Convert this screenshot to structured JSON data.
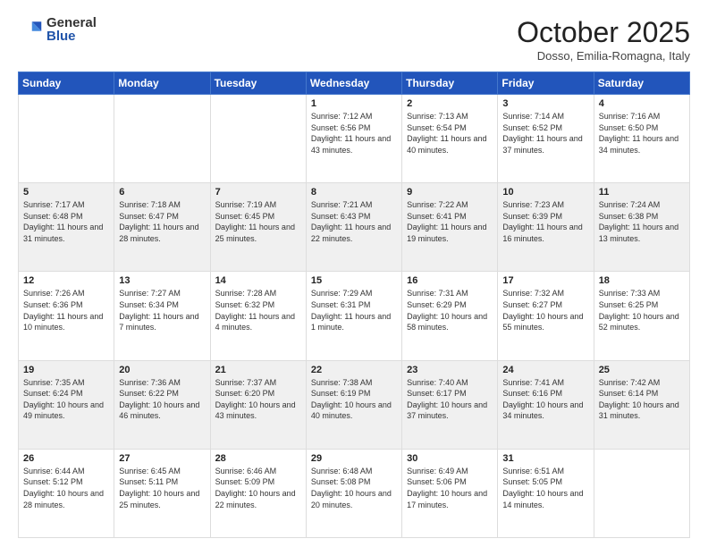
{
  "header": {
    "logo_general": "General",
    "logo_blue": "Blue",
    "month_title": "October 2025",
    "location": "Dosso, Emilia-Romagna, Italy"
  },
  "days_of_week": [
    "Sunday",
    "Monday",
    "Tuesday",
    "Wednesday",
    "Thursday",
    "Friday",
    "Saturday"
  ],
  "weeks": [
    [
      {
        "day": "",
        "info": ""
      },
      {
        "day": "",
        "info": ""
      },
      {
        "day": "",
        "info": ""
      },
      {
        "day": "1",
        "info": "Sunrise: 7:12 AM\nSunset: 6:56 PM\nDaylight: 11 hours and 43 minutes."
      },
      {
        "day": "2",
        "info": "Sunrise: 7:13 AM\nSunset: 6:54 PM\nDaylight: 11 hours and 40 minutes."
      },
      {
        "day": "3",
        "info": "Sunrise: 7:14 AM\nSunset: 6:52 PM\nDaylight: 11 hours and 37 minutes."
      },
      {
        "day": "4",
        "info": "Sunrise: 7:16 AM\nSunset: 6:50 PM\nDaylight: 11 hours and 34 minutes."
      }
    ],
    [
      {
        "day": "5",
        "info": "Sunrise: 7:17 AM\nSunset: 6:48 PM\nDaylight: 11 hours and 31 minutes."
      },
      {
        "day": "6",
        "info": "Sunrise: 7:18 AM\nSunset: 6:47 PM\nDaylight: 11 hours and 28 minutes."
      },
      {
        "day": "7",
        "info": "Sunrise: 7:19 AM\nSunset: 6:45 PM\nDaylight: 11 hours and 25 minutes."
      },
      {
        "day": "8",
        "info": "Sunrise: 7:21 AM\nSunset: 6:43 PM\nDaylight: 11 hours and 22 minutes."
      },
      {
        "day": "9",
        "info": "Sunrise: 7:22 AM\nSunset: 6:41 PM\nDaylight: 11 hours and 19 minutes."
      },
      {
        "day": "10",
        "info": "Sunrise: 7:23 AM\nSunset: 6:39 PM\nDaylight: 11 hours and 16 minutes."
      },
      {
        "day": "11",
        "info": "Sunrise: 7:24 AM\nSunset: 6:38 PM\nDaylight: 11 hours and 13 minutes."
      }
    ],
    [
      {
        "day": "12",
        "info": "Sunrise: 7:26 AM\nSunset: 6:36 PM\nDaylight: 11 hours and 10 minutes."
      },
      {
        "day": "13",
        "info": "Sunrise: 7:27 AM\nSunset: 6:34 PM\nDaylight: 11 hours and 7 minutes."
      },
      {
        "day": "14",
        "info": "Sunrise: 7:28 AM\nSunset: 6:32 PM\nDaylight: 11 hours and 4 minutes."
      },
      {
        "day": "15",
        "info": "Sunrise: 7:29 AM\nSunset: 6:31 PM\nDaylight: 11 hours and 1 minute."
      },
      {
        "day": "16",
        "info": "Sunrise: 7:31 AM\nSunset: 6:29 PM\nDaylight: 10 hours and 58 minutes."
      },
      {
        "day": "17",
        "info": "Sunrise: 7:32 AM\nSunset: 6:27 PM\nDaylight: 10 hours and 55 minutes."
      },
      {
        "day": "18",
        "info": "Sunrise: 7:33 AM\nSunset: 6:25 PM\nDaylight: 10 hours and 52 minutes."
      }
    ],
    [
      {
        "day": "19",
        "info": "Sunrise: 7:35 AM\nSunset: 6:24 PM\nDaylight: 10 hours and 49 minutes."
      },
      {
        "day": "20",
        "info": "Sunrise: 7:36 AM\nSunset: 6:22 PM\nDaylight: 10 hours and 46 minutes."
      },
      {
        "day": "21",
        "info": "Sunrise: 7:37 AM\nSunset: 6:20 PM\nDaylight: 10 hours and 43 minutes."
      },
      {
        "day": "22",
        "info": "Sunrise: 7:38 AM\nSunset: 6:19 PM\nDaylight: 10 hours and 40 minutes."
      },
      {
        "day": "23",
        "info": "Sunrise: 7:40 AM\nSunset: 6:17 PM\nDaylight: 10 hours and 37 minutes."
      },
      {
        "day": "24",
        "info": "Sunrise: 7:41 AM\nSunset: 6:16 PM\nDaylight: 10 hours and 34 minutes."
      },
      {
        "day": "25",
        "info": "Sunrise: 7:42 AM\nSunset: 6:14 PM\nDaylight: 10 hours and 31 minutes."
      }
    ],
    [
      {
        "day": "26",
        "info": "Sunrise: 6:44 AM\nSunset: 5:12 PM\nDaylight: 10 hours and 28 minutes."
      },
      {
        "day": "27",
        "info": "Sunrise: 6:45 AM\nSunset: 5:11 PM\nDaylight: 10 hours and 25 minutes."
      },
      {
        "day": "28",
        "info": "Sunrise: 6:46 AM\nSunset: 5:09 PM\nDaylight: 10 hours and 22 minutes."
      },
      {
        "day": "29",
        "info": "Sunrise: 6:48 AM\nSunset: 5:08 PM\nDaylight: 10 hours and 20 minutes."
      },
      {
        "day": "30",
        "info": "Sunrise: 6:49 AM\nSunset: 5:06 PM\nDaylight: 10 hours and 17 minutes."
      },
      {
        "day": "31",
        "info": "Sunrise: 6:51 AM\nSunset: 5:05 PM\nDaylight: 10 hours and 14 minutes."
      },
      {
        "day": "",
        "info": ""
      }
    ]
  ]
}
